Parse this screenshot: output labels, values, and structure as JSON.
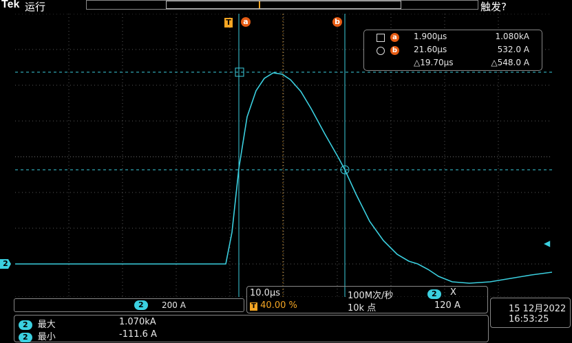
{
  "header": {
    "brand": "Tek",
    "run_state": "运行",
    "trigger_status": "触发?"
  },
  "cursors": {
    "a_label": "a",
    "b_label": "b",
    "trigger_label": "T",
    "readout": {
      "a_time": "1.900µs",
      "a_value": "1.080kA",
      "b_time": "21.60µs",
      "b_value": "532.0 A",
      "delta_time": "△19.70µs",
      "delta_value": "△548.0 A"
    }
  },
  "channel": {
    "number": "2",
    "scale": "200 A"
  },
  "horizontal": {
    "time_div": "10.0µs",
    "sample_rate": "100M次/秒",
    "trigger_position": "40.00 %",
    "record_length": "10k 点",
    "trigger_channel": "2",
    "trigger_slope_symbol": "X",
    "trigger_level": "120 A"
  },
  "datetime": {
    "date": "15 12月2022",
    "time": "16:53:25"
  },
  "measurements": [
    {
      "channel": "2",
      "name": "最大",
      "value": "1.070kA"
    },
    {
      "channel": "2",
      "name": "最小",
      "value": "-111.6 A"
    }
  ],
  "colors": {
    "trace": "#3bd0e0",
    "cursor": "#3bd0e0",
    "grid": "#5a5a5a",
    "trigger": "#f5a623",
    "cursor_badge": "#e55b13"
  }
}
